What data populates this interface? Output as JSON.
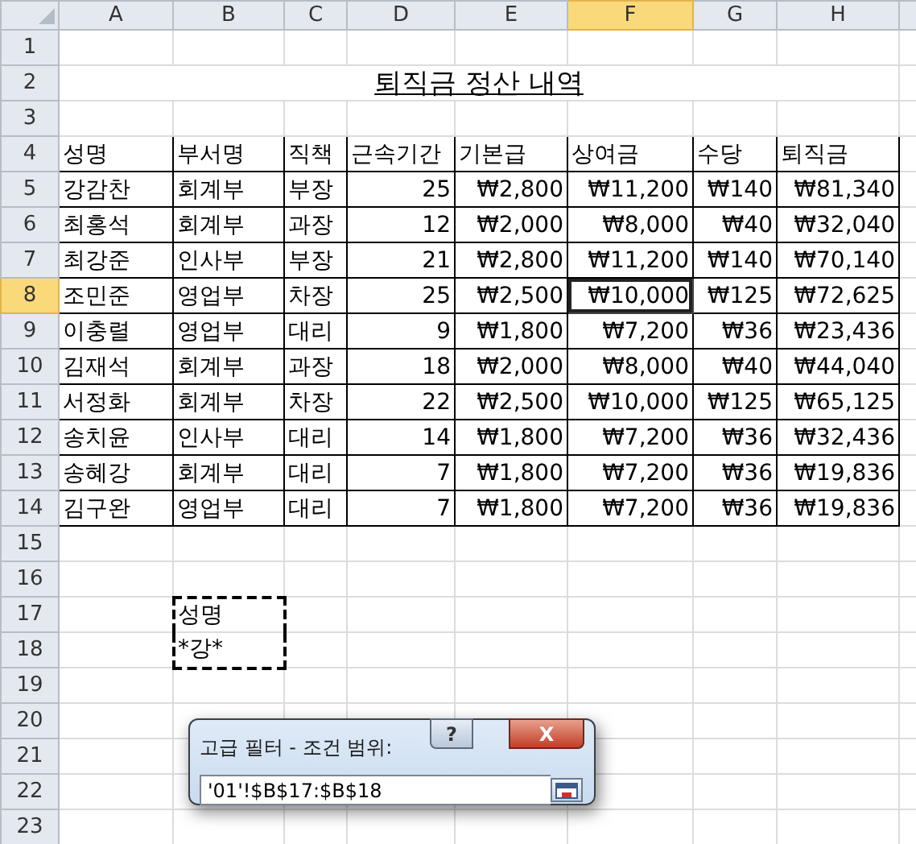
{
  "columns": [
    {
      "label": "A",
      "selected": false
    },
    {
      "label": "B",
      "selected": false
    },
    {
      "label": "C",
      "selected": false
    },
    {
      "label": "D",
      "selected": false
    },
    {
      "label": "E",
      "selected": false
    },
    {
      "label": "F",
      "selected": true
    },
    {
      "label": "G",
      "selected": false
    },
    {
      "label": "H",
      "selected": false
    }
  ],
  "row_numbers": [
    {
      "label": "1",
      "selected": false
    },
    {
      "label": "2",
      "selected": false
    },
    {
      "label": "3",
      "selected": false
    },
    {
      "label": "4",
      "selected": false
    },
    {
      "label": "5",
      "selected": false
    },
    {
      "label": "6",
      "selected": false
    },
    {
      "label": "7",
      "selected": false
    },
    {
      "label": "8",
      "selected": true
    },
    {
      "label": "9",
      "selected": false
    },
    {
      "label": "10",
      "selected": false
    },
    {
      "label": "11",
      "selected": false
    },
    {
      "label": "12",
      "selected": false
    },
    {
      "label": "13",
      "selected": false
    },
    {
      "label": "14",
      "selected": false
    },
    {
      "label": "15",
      "selected": false
    },
    {
      "label": "16",
      "selected": false
    },
    {
      "label": "17",
      "selected": false
    },
    {
      "label": "18",
      "selected": false
    },
    {
      "label": "19",
      "selected": false
    },
    {
      "label": "20",
      "selected": false
    },
    {
      "label": "21",
      "selected": false
    },
    {
      "label": "22",
      "selected": false
    },
    {
      "label": "23",
      "selected": false
    }
  ],
  "title": "퇴직금 정산 내역",
  "data_table": {
    "headers": [
      "성명",
      "부서명",
      "직책",
      "근속기간",
      "기본급",
      "상여금",
      "수당",
      "퇴직금"
    ],
    "rows": [
      {
        "selected": false,
        "cells": [
          "강감찬",
          "회계부",
          "부장",
          "25",
          "₩2,800",
          "₩11,200",
          "₩140",
          "₩81,340"
        ]
      },
      {
        "selected": false,
        "cells": [
          "최홍석",
          "회계부",
          "과장",
          "12",
          "₩2,000",
          "₩8,000",
          "₩40",
          "₩32,040"
        ]
      },
      {
        "selected": false,
        "cells": [
          "최강준",
          "인사부",
          "부장",
          "21",
          "₩2,800",
          "₩11,200",
          "₩140",
          "₩70,140"
        ]
      },
      {
        "selected": true,
        "cells": [
          "조민준",
          "영업부",
          "차장",
          "25",
          "₩2,500",
          "₩10,000",
          "₩125",
          "₩72,625"
        ]
      },
      {
        "selected": false,
        "cells": [
          "이충렬",
          "영업부",
          "대리",
          "9",
          "₩1,800",
          "₩7,200",
          "₩36",
          "₩23,436"
        ]
      },
      {
        "selected": false,
        "cells": [
          "김재석",
          "회계부",
          "과장",
          "18",
          "₩2,000",
          "₩8,000",
          "₩40",
          "₩44,040"
        ]
      },
      {
        "selected": false,
        "cells": [
          "서정화",
          "회계부",
          "차장",
          "22",
          "₩2,500",
          "₩10,000",
          "₩125",
          "₩65,125"
        ]
      },
      {
        "selected": false,
        "cells": [
          "송치윤",
          "인사부",
          "대리",
          "14",
          "₩1,800",
          "₩7,200",
          "₩36",
          "₩32,436"
        ]
      },
      {
        "selected": false,
        "cells": [
          "송혜강",
          "회계부",
          "대리",
          "7",
          "₩1,800",
          "₩7,200",
          "₩36",
          "₩19,836"
        ]
      },
      {
        "selected": false,
        "cells": [
          "김구완",
          "영업부",
          "대리",
          "7",
          "₩1,800",
          "₩7,200",
          "₩36",
          "₩19,836"
        ]
      }
    ]
  },
  "criteria_range": {
    "marching_ants": true,
    "cells": [
      "성명",
      "*강*"
    ]
  },
  "dialog": {
    "title": "고급 필터 - 조건 범위:",
    "help": "?",
    "close": "X",
    "value": "'01'!$B$17:$B$18"
  }
}
